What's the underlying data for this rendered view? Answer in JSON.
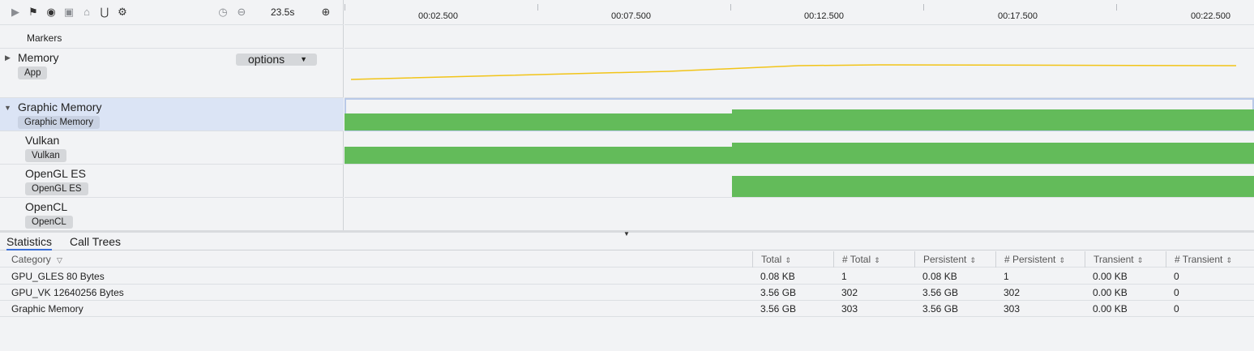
{
  "toolbar": {
    "icons": [
      "play-icon",
      "flag-icon",
      "record-icon",
      "capture-icon",
      "export-icon",
      "filter-icon",
      "settings-icon",
      "timer-icon",
      "zoom-out-icon",
      "zoom-in-icon"
    ],
    "duration": "23.5s"
  },
  "ruler": {
    "labels": [
      "00:02.500",
      "00:07.500",
      "00:12.500",
      "00:17.500",
      "00:22.500"
    ]
  },
  "markers": {
    "label": "Markers"
  },
  "tracks": {
    "memory": {
      "title": "Memory",
      "badge": "App",
      "options": "options"
    },
    "graphic": {
      "title": "Graphic Memory",
      "badge": "Graphic Memory"
    },
    "vulkan": {
      "title": "Vulkan",
      "badge": "Vulkan"
    },
    "opengl": {
      "title": "OpenGL ES",
      "badge": "OpenGL ES"
    },
    "opencl": {
      "title": "OpenCL",
      "badge": "OpenCL"
    }
  },
  "colors": {
    "memory_line": "#f2c418",
    "bar": "#63bb5a",
    "tab_active": "#3a6fd8"
  },
  "tabs": {
    "statistics": "Statistics",
    "call_trees": "Call Trees"
  },
  "table": {
    "headers": [
      "Category",
      "Total",
      "# Total",
      "Persistent",
      "# Persistent",
      "Transient",
      "# Transient"
    ],
    "rows": [
      [
        "GPU_GLES 80 Bytes",
        "0.08 KB",
        "1",
        "0.08 KB",
        "1",
        "0.00 KB",
        "0"
      ],
      [
        "GPU_VK 12640256 Bytes",
        "3.56 GB",
        "302",
        "3.56 GB",
        "302",
        "0.00 KB",
        "0"
      ],
      [
        "Graphic Memory",
        "3.56 GB",
        "303",
        "3.56 GB",
        "303",
        "0.00 KB",
        "0"
      ]
    ]
  }
}
